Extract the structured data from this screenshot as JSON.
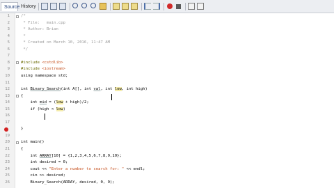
{
  "tabs": {
    "source": "Source",
    "history": "History"
  },
  "toolbar_icons": [
    "back-icon",
    "forward-icon",
    "toggle-icon",
    "find-icon",
    "find-prev-icon",
    "find-next-icon",
    "toggle-highlight-icon",
    "toggle-bookmark-icon",
    "prev-bookmark-icon",
    "next-bookmark-icon",
    "shift-left-icon",
    "shift-right-icon",
    "record-macro-icon",
    "stop-macro-icon",
    "comment-icon",
    "uncomment-icon"
  ],
  "editor": {
    "lines": [
      {
        "n": "1",
        "fold": true,
        "segs": [
          {
            "t": "/*",
            "c": "comment"
          }
        ]
      },
      {
        "n": "2",
        "segs": [
          {
            "t": " * File:   main.cpp",
            "c": "comment"
          }
        ]
      },
      {
        "n": "3",
        "segs": [
          {
            "t": " * Author: Brian",
            "c": "comment"
          }
        ]
      },
      {
        "n": "4",
        "segs": [
          {
            "t": " *",
            "c": "comment"
          }
        ]
      },
      {
        "n": "5",
        "segs": [
          {
            "t": " * Created on March 10, 2016, 11:47 AM",
            "c": "comment"
          }
        ]
      },
      {
        "n": "6",
        "segs": [
          {
            "t": " */",
            "c": "comment"
          }
        ]
      },
      {
        "n": "7",
        "segs": []
      },
      {
        "n": "8",
        "fold": true,
        "segs": [
          {
            "t": "#include ",
            "c": "pp"
          },
          {
            "t": "<cstdlib>",
            "c": "str"
          }
        ]
      },
      {
        "n": "9",
        "segs": [
          {
            "t": "#include ",
            "c": "pp"
          },
          {
            "t": "<iostream>",
            "c": "str"
          }
        ]
      },
      {
        "n": "10",
        "segs": [
          {
            "t": "using namespace std;",
            "c": ""
          }
        ]
      },
      {
        "n": "11",
        "segs": []
      },
      {
        "n": "12",
        "segs": [
          {
            "t": "int ",
            "c": ""
          },
          {
            "t": "Binary_Search",
            "c": "und"
          },
          {
            "t": "(int A[], int ",
            "c": ""
          },
          {
            "t": "val",
            "c": "und"
          },
          {
            "t": ", int ",
            "c": ""
          },
          {
            "t": "low",
            "c": "hl"
          },
          {
            "t": ", int high)",
            "c": ""
          }
        ]
      },
      {
        "n": "13",
        "fold": true,
        "segs": [
          {
            "t": "{",
            "c": ""
          }
        ]
      },
      {
        "n": "14",
        "segs": [
          {
            "t": "    int ",
            "c": ""
          },
          {
            "t": "mid",
            "c": "und"
          },
          {
            "t": " = (",
            "c": ""
          },
          {
            "t": "low",
            "c": "hl"
          },
          {
            "t": " + high)/2;",
            "c": ""
          }
        ]
      },
      {
        "n": "15",
        "segs": [
          {
            "t": "    if (high < ",
            "c": ""
          },
          {
            "t": "low",
            "c": "hl"
          },
          {
            "t": ")",
            "c": ""
          }
        ]
      },
      {
        "n": "16",
        "segs": []
      },
      {
        "n": "17",
        "segs": []
      },
      {
        "n": "18",
        "error": true,
        "segs": [
          {
            "t": "}",
            "c": ""
          }
        ]
      },
      {
        "n": "19",
        "segs": []
      },
      {
        "n": "20",
        "fold": true,
        "segs": [
          {
            "t": "int main()",
            "c": ""
          }
        ]
      },
      {
        "n": "21",
        "segs": [
          {
            "t": "{",
            "c": ""
          }
        ]
      },
      {
        "n": "22",
        "segs": [
          {
            "t": "    int ",
            "c": ""
          },
          {
            "t": "ARRAY",
            "c": "und"
          },
          {
            "t": "[10] = {1,2,3,4,5,6,7,8,9,10};",
            "c": ""
          }
        ]
      },
      {
        "n": "23",
        "segs": [
          {
            "t": "    int desired = 0;",
            "c": ""
          }
        ]
      },
      {
        "n": "24",
        "segs": [
          {
            "t": "    cout << ",
            "c": ""
          },
          {
            "t": "\"Enter a number to search for: \"",
            "c": "str"
          },
          {
            "t": " << endl;",
            "c": ""
          }
        ]
      },
      {
        "n": "25",
        "segs": [
          {
            "t": "    cin >> desired;",
            "c": ""
          }
        ]
      },
      {
        "n": "26",
        "segs": [
          {
            "t": "    Binary_Search(ARRAY, desired, 0, 9);",
            "c": ""
          }
        ]
      }
    ]
  }
}
